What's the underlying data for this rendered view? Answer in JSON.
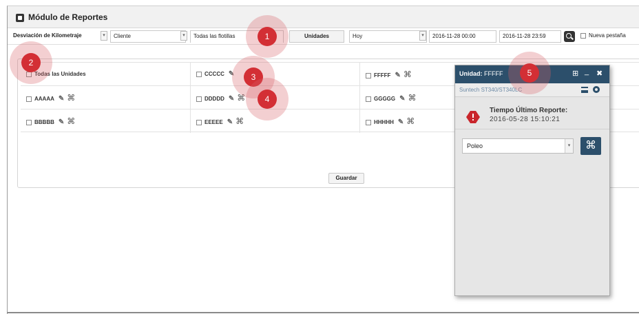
{
  "window": {
    "title": "Módulo de Reportes"
  },
  "toolbar": {
    "report_type": "Desviación de Kilometraje",
    "client": "Cliente",
    "fleets_tab": "Todas las flotillas",
    "units_tab": "Unidades",
    "range": "Hoy",
    "date_from": "2016-11-28 00:00",
    "date_to": "2016-11-28 23:59",
    "new_tab_label": "Nueva pestaña"
  },
  "units": {
    "all_label": "Todas las Unidades",
    "col1": [
      "AAAAA",
      "BBBBB"
    ],
    "col2": [
      "CCCCC",
      "DDDDD",
      "EEEEE"
    ],
    "col3": [
      "FFFFF",
      "GGGGG",
      "HHHHH"
    ]
  },
  "save_label": "Guardar",
  "popup": {
    "title_prefix": "Unidad:",
    "title_value": "FFFFF",
    "device": "Suntech ST340/ST340LC",
    "alert_title": "Tiempo Último Reporte:",
    "alert_time": "2016-05-28 15:10:21",
    "select_value": "Poleo",
    "command_symbol": "⌘"
  },
  "callouts": [
    "1",
    "2",
    "3",
    "4",
    "5"
  ],
  "colors": {
    "popup_header": "#2c4f6b",
    "callout": "#d32f35",
    "alert": "#c9252b"
  }
}
